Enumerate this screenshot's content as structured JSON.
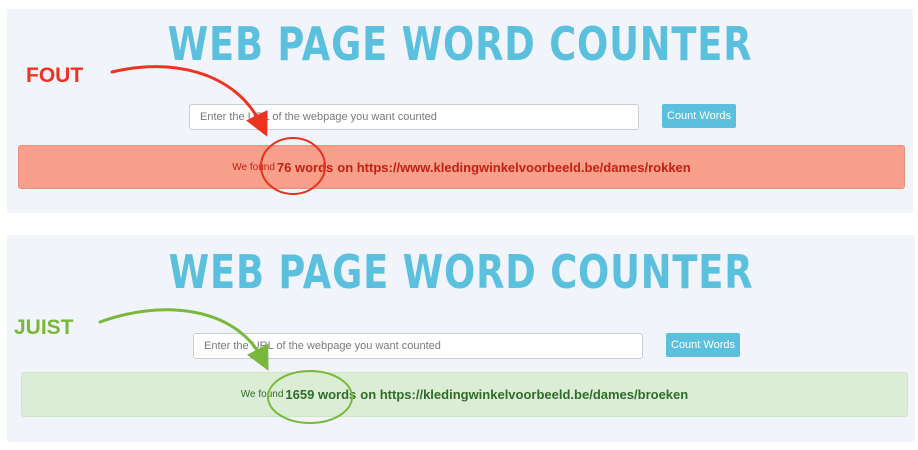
{
  "colors": {
    "title": "#5bc0de",
    "button": "#5bc0de",
    "error_bg": "#f8a08c",
    "error_text": "#c81e0f",
    "success_bg": "#dbeed5",
    "success_text": "#2f6b2a",
    "annotation_wrong": "#ef3320",
    "annotation_right": "#79b83a"
  },
  "annotations": {
    "wrong_label": "FOUT",
    "right_label": "JUIST"
  },
  "top_panel": {
    "title": "WEB PAGE WORD COUNTER",
    "input_placeholder": "Enter the URL of the webpage you want counted",
    "button_label": "Count Words",
    "result_prefix": "We found",
    "result_count": "76 words",
    "result_suffix": "on https://www.kledingwinkelvoorbeeld.be/dames/rokken"
  },
  "bottom_panel": {
    "title": "WEB PAGE WORD COUNTER",
    "input_placeholder": "Enter the URL of the webpage you want counted",
    "button_label": "Count Words",
    "result_prefix": "We found",
    "result_count": "1659 words",
    "result_suffix": "on https://kledingwinkelvoorbeeld.be/dames/broeken"
  }
}
